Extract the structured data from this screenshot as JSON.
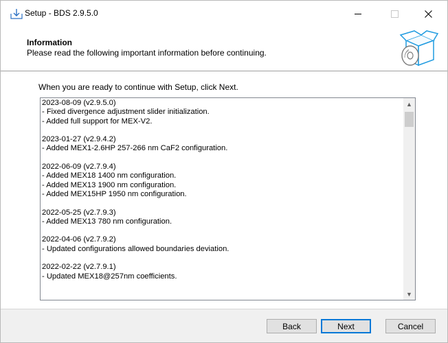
{
  "window": {
    "title": "Setup - BDS 2.9.5.0",
    "icons": {
      "app": "setup-installer-icon",
      "minimize": "minimize-icon",
      "maximize": "maximize-icon",
      "close": "close-icon"
    }
  },
  "header": {
    "title": "Information",
    "subtitle": "Please read the following important information before continuing.",
    "icon": "software-box-disc-icon"
  },
  "main": {
    "intro": "When you are ready to continue with Setup, click Next.",
    "memo_lines": [
      "2023-08-09 (v2.9.5.0)",
      "- Fixed divergence adjustment slider initialization.",
      "- Added full support for MEX-V2.",
      "",
      "2023-01-27 (v2.9.4.2)",
      "- Added MEX1-2.6HP 257-266 nm CaF2 configuration.",
      "",
      "2022-06-09 (v2.7.9.4)",
      "- Added MEX18 1400 nm configuration.",
      "- Added MEX13 1900 nm configuration.",
      "- Added MEX15HP 1950 nm configuration.",
      "",
      "2022-05-25 (v2.7.9.3)",
      "- Added MEX13 780 nm configuration.",
      "",
      "2022-04-06 (v2.7.9.2)",
      "- Updated configurations allowed boundaries deviation.",
      "",
      "2022-02-22 (v2.7.9.1)",
      "- Updated MEX18@257nm coefficients."
    ],
    "scroll_icons": {
      "up": "scroll-up-icon",
      "down": "scroll-down-icon"
    }
  },
  "footer": {
    "back_label": "Back",
    "next_label": "Next",
    "cancel_label": "Cancel"
  },
  "colors": {
    "default_button_border": "#0078d7",
    "footer_bg": "#f0f0f0"
  }
}
